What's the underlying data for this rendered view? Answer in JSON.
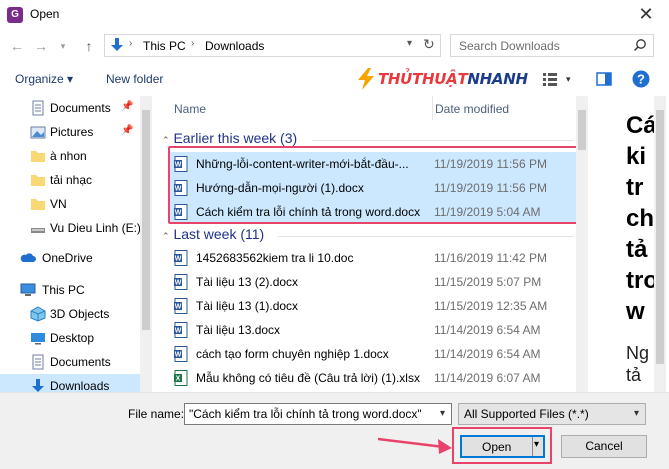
{
  "window": {
    "title": "Open",
    "app_icon_letter": "G"
  },
  "address": {
    "segments": [
      "This PC",
      "Downloads"
    ]
  },
  "search": {
    "placeholder": "Search Downloads"
  },
  "toolbar": {
    "organize_label": "Organize ▾",
    "new_folder_label": "New folder",
    "logo_text": "THỦTHUẬTNHANH"
  },
  "sidebar": {
    "items": [
      {
        "label": "Documents",
        "icon": "documents-icon",
        "pinned": true
      },
      {
        "label": "Pictures",
        "icon": "pictures-icon",
        "pinned": true
      },
      {
        "label": "à nhon",
        "icon": "folder-icon",
        "pinned": false
      },
      {
        "label": "tải nhạc",
        "icon": "folder-icon",
        "pinned": false
      },
      {
        "label": "VN",
        "icon": "folder-icon",
        "pinned": false
      },
      {
        "label": "Vu Dieu Linh (E:)",
        "icon": "drive-icon",
        "pinned": false
      },
      {
        "label": "OneDrive",
        "icon": "cloud-icon",
        "pinned": false
      },
      {
        "label": "This PC",
        "icon": "computer-icon",
        "pinned": false
      },
      {
        "label": "3D Objects",
        "icon": "cube-icon",
        "pinned": false
      },
      {
        "label": "Desktop",
        "icon": "desktop-icon",
        "pinned": false
      },
      {
        "label": "Documents",
        "icon": "documents-icon",
        "pinned": false
      },
      {
        "label": "Downloads",
        "icon": "download-icon",
        "pinned": false,
        "selected": true
      }
    ]
  },
  "columns": {
    "name": "Name",
    "date": "Date modified"
  },
  "groups": [
    {
      "label": "Earlier this week (3)",
      "files": [
        {
          "name": "Những-lỗi-content-writer-mới-bắt-đầu-...",
          "date": "11/19/2019 11:56 PM",
          "type": "word",
          "selected": true
        },
        {
          "name": "Hướng-dẫn-mọi-người (1).docx",
          "date": "11/19/2019 11:56 PM",
          "type": "word",
          "selected": true
        },
        {
          "name": "Cách kiểm tra lỗi chính tả trong word.docx",
          "date": "11/19/2019 5:04 AM",
          "type": "word",
          "selected": true
        }
      ]
    },
    {
      "label": "Last week (11)",
      "files": [
        {
          "name": "1452683562kiem tra li 10.doc",
          "date": "11/16/2019 11:42 PM",
          "type": "word",
          "selected": false
        },
        {
          "name": "Tài liệu 13 (2).docx",
          "date": "11/15/2019 5:07 PM",
          "type": "word",
          "selected": false
        },
        {
          "name": "Tài liệu 13 (1).docx",
          "date": "11/15/2019 12:35 AM",
          "type": "word",
          "selected": false
        },
        {
          "name": "Tài liệu 13.docx",
          "date": "11/14/2019 6:54 AM",
          "type": "word",
          "selected": false
        },
        {
          "name": "cách tạo form chuyên nghiệp 1.docx",
          "date": "11/14/2019 6:54 AM",
          "type": "word",
          "selected": false
        },
        {
          "name": "Mẫu không có tiêu đề (Câu trả lời) (1).xlsx",
          "date": "11/14/2019 6:07 AM",
          "type": "excel",
          "selected": false
        }
      ]
    }
  ],
  "preview": {
    "lines": [
      "Cá",
      "ki",
      "tr",
      "ch",
      "tả",
      "tro",
      "w"
    ],
    "sub_lines": [
      "Ng",
      "tả"
    ]
  },
  "footer": {
    "file_name_label": "File name:",
    "file_name_value": "\"Cách kiểm tra lỗi chính tả trong word.docx\"",
    "file_type_value": "All Supported Files (*.*)",
    "open_label": "Open",
    "cancel_label": "Cancel"
  },
  "colors": {
    "accent": "#0078d7",
    "selection": "#cce8ff",
    "highlight": "#e8436b",
    "group": "#1e3287"
  }
}
